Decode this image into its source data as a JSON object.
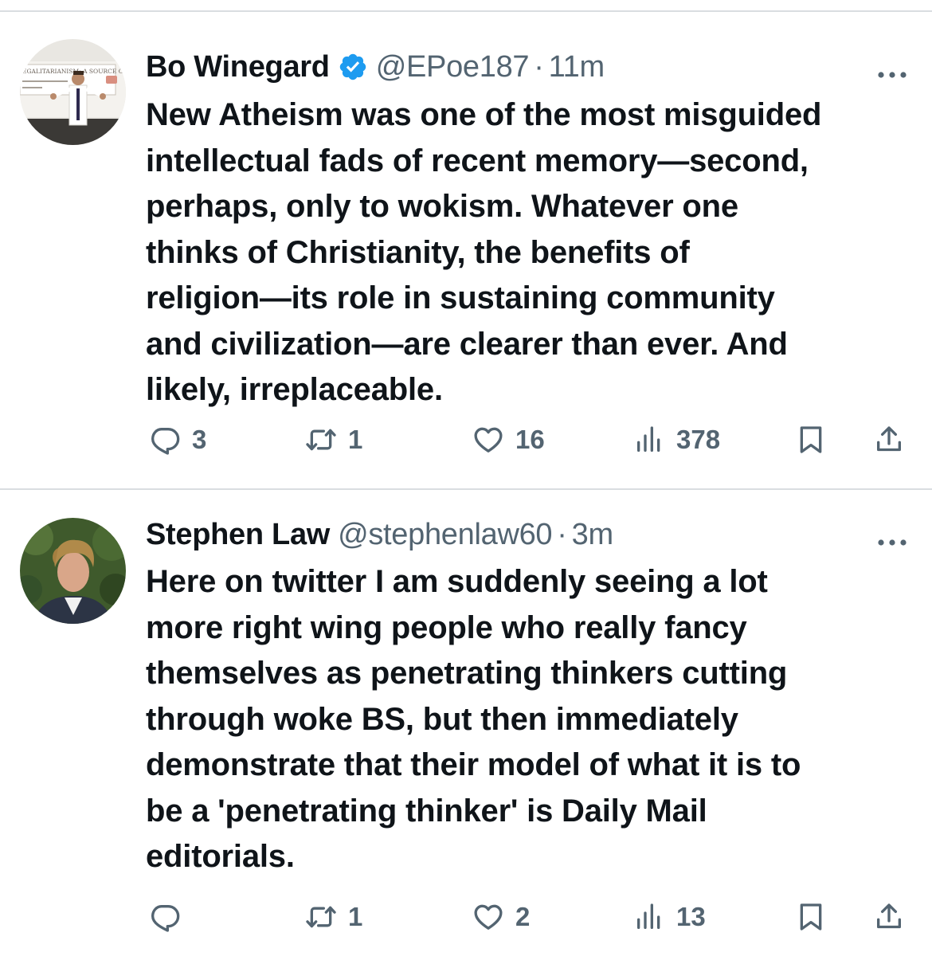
{
  "tweets": [
    {
      "author_name": "Bo Winegard",
      "verified": true,
      "handle": "@EPoe187",
      "separator": "·",
      "time": "11m",
      "text_lines": [
        "New Atheism was one of the most misguided",
        "intellectual fads of recent memory—second,",
        "perhaps, only to wokism. Whatever one",
        "thinks of Christianity, the benefits of",
        "religion—its role in sustaining community",
        "and civilization—are clearer than ever. And",
        "likely, irreplaceable."
      ],
      "avatar_sign_text": "EGALITARIANISM: A SOURCE OF MORAL",
      "stats": {
        "replies": "3",
        "reposts": "1",
        "likes": "16",
        "views": "378"
      }
    },
    {
      "author_name": "Stephen Law",
      "verified": false,
      "handle": "@stephenlaw60",
      "separator": "·",
      "time": "3m",
      "text_lines": [
        "Here on twitter I am suddenly seeing a lot",
        "more right wing people who really fancy",
        "themselves as penetrating thinkers cutting",
        "through woke BS, but then immediately",
        "demonstrate that their model of what it is to",
        "be a 'penetrating thinker' is Daily Mail",
        "editorials."
      ],
      "stats": {
        "replies": "",
        "reposts": "1",
        "likes": "2",
        "views": "13"
      }
    }
  ],
  "colors": {
    "text_primary": "#0f1419",
    "text_secondary": "#536471",
    "verified_badge": "#1d9bf0",
    "divider": "#d9dde1"
  },
  "icons": {
    "more": "more-options-icon",
    "verified": "verified-badge-icon",
    "reply": "reply-icon",
    "repost": "repost-icon",
    "like": "heart-icon",
    "views": "views-chart-icon",
    "bookmark": "bookmark-icon",
    "share": "share-icon"
  }
}
